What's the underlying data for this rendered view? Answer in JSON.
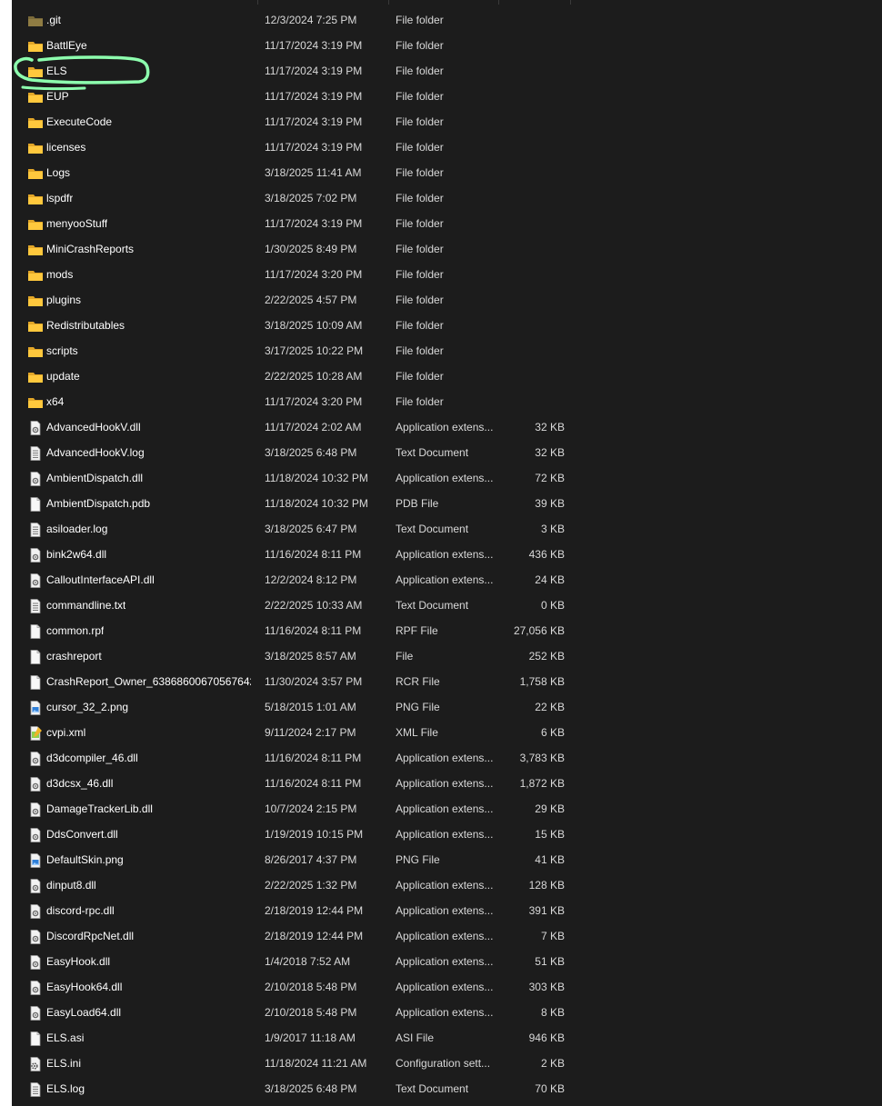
{
  "files": [
    {
      "name": ".git",
      "date": "12/3/2024 7:25 PM",
      "type": "File folder",
      "size": "",
      "icon": "folder-dim-icon"
    },
    {
      "name": "BattlEye",
      "date": "11/17/2024 3:19 PM",
      "type": "File folder",
      "size": "",
      "icon": "folder-icon"
    },
    {
      "name": "ELS",
      "date": "11/17/2024 3:19 PM",
      "type": "File folder",
      "size": "",
      "icon": "folder-icon"
    },
    {
      "name": "EUP",
      "date": "11/17/2024 3:19 PM",
      "type": "File folder",
      "size": "",
      "icon": "folder-icon"
    },
    {
      "name": "ExecuteCode",
      "date": "11/17/2024 3:19 PM",
      "type": "File folder",
      "size": "",
      "icon": "folder-icon"
    },
    {
      "name": "licenses",
      "date": "11/17/2024 3:19 PM",
      "type": "File folder",
      "size": "",
      "icon": "folder-icon"
    },
    {
      "name": "Logs",
      "date": "3/18/2025 11:41 AM",
      "type": "File folder",
      "size": "",
      "icon": "folder-icon"
    },
    {
      "name": "lspdfr",
      "date": "3/18/2025 7:02 PM",
      "type": "File folder",
      "size": "",
      "icon": "folder-icon"
    },
    {
      "name": "menyooStuff",
      "date": "11/17/2024 3:19 PM",
      "type": "File folder",
      "size": "",
      "icon": "folder-icon"
    },
    {
      "name": "MiniCrashReports",
      "date": "1/30/2025 8:49 PM",
      "type": "File folder",
      "size": "",
      "icon": "folder-icon"
    },
    {
      "name": "mods",
      "date": "11/17/2024 3:20 PM",
      "type": "File folder",
      "size": "",
      "icon": "folder-icon"
    },
    {
      "name": "plugins",
      "date": "2/22/2025 4:57 PM",
      "type": "File folder",
      "size": "",
      "icon": "folder-icon"
    },
    {
      "name": "Redistributables",
      "date": "3/18/2025 10:09 AM",
      "type": "File folder",
      "size": "",
      "icon": "folder-icon"
    },
    {
      "name": "scripts",
      "date": "3/17/2025 10:22 PM",
      "type": "File folder",
      "size": "",
      "icon": "folder-icon"
    },
    {
      "name": "update",
      "date": "2/22/2025 10:28 AM",
      "type": "File folder",
      "size": "",
      "icon": "folder-icon"
    },
    {
      "name": "x64",
      "date": "11/17/2024 3:20 PM",
      "type": "File folder",
      "size": "",
      "icon": "folder-icon"
    },
    {
      "name": "AdvancedHookV.dll",
      "date": "11/17/2024 2:02 AM",
      "type": "Application extens...",
      "size": "32 KB",
      "icon": "dll-file-icon"
    },
    {
      "name": "AdvancedHookV.log",
      "date": "3/18/2025 6:48 PM",
      "type": "Text Document",
      "size": "32 KB",
      "icon": "text-file-icon"
    },
    {
      "name": "AmbientDispatch.dll",
      "date": "11/18/2024 10:32 PM",
      "type": "Application extens...",
      "size": "72 KB",
      "icon": "dll-file-icon"
    },
    {
      "name": "AmbientDispatch.pdb",
      "date": "11/18/2024 10:32 PM",
      "type": "PDB File",
      "size": "39 KB",
      "icon": "blank-file-icon"
    },
    {
      "name": "asiloader.log",
      "date": "3/18/2025 6:47 PM",
      "type": "Text Document",
      "size": "3 KB",
      "icon": "text-file-icon"
    },
    {
      "name": "bink2w64.dll",
      "date": "11/16/2024 8:11 PM",
      "type": "Application extens...",
      "size": "436 KB",
      "icon": "dll-file-icon"
    },
    {
      "name": "CalloutInterfaceAPI.dll",
      "date": "12/2/2024 8:12 PM",
      "type": "Application extens...",
      "size": "24 KB",
      "icon": "dll-file-icon"
    },
    {
      "name": "commandline.txt",
      "date": "2/22/2025 10:33 AM",
      "type": "Text Document",
      "size": "0 KB",
      "icon": "text-file-icon"
    },
    {
      "name": "common.rpf",
      "date": "11/16/2024 8:11 PM",
      "type": "RPF File",
      "size": "27,056 KB",
      "icon": "blank-file-icon"
    },
    {
      "name": "crashreport",
      "date": "3/18/2025 8:57 AM",
      "type": "File",
      "size": "252 KB",
      "icon": "blank-file-icon"
    },
    {
      "name": "CrashReport_Owner_63868600670567642...",
      "date": "11/30/2024 3:57 PM",
      "type": "RCR File",
      "size": "1,758 KB",
      "icon": "blank-file-icon"
    },
    {
      "name": "cursor_32_2.png",
      "date": "5/18/2015 1:01 AM",
      "type": "PNG File",
      "size": "22 KB",
      "icon": "image-file-icon"
    },
    {
      "name": "cvpi.xml",
      "date": "9/11/2024 2:17 PM",
      "type": "XML File",
      "size": "6 KB",
      "icon": "xml-file-icon"
    },
    {
      "name": "d3dcompiler_46.dll",
      "date": "11/16/2024 8:11 PM",
      "type": "Application extens...",
      "size": "3,783 KB",
      "icon": "dll-file-icon"
    },
    {
      "name": "d3dcsx_46.dll",
      "date": "11/16/2024 8:11 PM",
      "type": "Application extens...",
      "size": "1,872 KB",
      "icon": "dll-file-icon"
    },
    {
      "name": "DamageTrackerLib.dll",
      "date": "10/7/2024 2:15 PM",
      "type": "Application extens...",
      "size": "29 KB",
      "icon": "dll-file-icon"
    },
    {
      "name": "DdsConvert.dll",
      "date": "1/19/2019 10:15 PM",
      "type": "Application extens...",
      "size": "15 KB",
      "icon": "dll-file-icon"
    },
    {
      "name": "DefaultSkin.png",
      "date": "8/26/2017 4:37 PM",
      "type": "PNG File",
      "size": "41 KB",
      "icon": "image-file-icon"
    },
    {
      "name": "dinput8.dll",
      "date": "2/22/2025 1:32 PM",
      "type": "Application extens...",
      "size": "128 KB",
      "icon": "dll-file-icon"
    },
    {
      "name": "discord-rpc.dll",
      "date": "2/18/2019 12:44 PM",
      "type": "Application extens...",
      "size": "391 KB",
      "icon": "dll-file-icon"
    },
    {
      "name": "DiscordRpcNet.dll",
      "date": "2/18/2019 12:44 PM",
      "type": "Application extens...",
      "size": "7 KB",
      "icon": "dll-file-icon"
    },
    {
      "name": "EasyHook.dll",
      "date": "1/4/2018 7:52 AM",
      "type": "Application extens...",
      "size": "51 KB",
      "icon": "dll-file-icon"
    },
    {
      "name": "EasyHook64.dll",
      "date": "2/10/2018 5:48 PM",
      "type": "Application extens...",
      "size": "303 KB",
      "icon": "dll-file-icon"
    },
    {
      "name": "EasyLoad64.dll",
      "date": "2/10/2018 5:48 PM",
      "type": "Application extens...",
      "size": "8 KB",
      "icon": "dll-file-icon"
    },
    {
      "name": "ELS.asi",
      "date": "1/9/2017 11:18 AM",
      "type": "ASI File",
      "size": "946 KB",
      "icon": "blank-file-icon"
    },
    {
      "name": "ELS.ini",
      "date": "11/18/2024 11:21 AM",
      "type": "Configuration sett...",
      "size": "2 KB",
      "icon": "config-file-icon"
    },
    {
      "name": "ELS.log",
      "date": "3/18/2025 6:48 PM",
      "type": "Text Document",
      "size": "70 KB",
      "icon": "text-file-icon"
    }
  ],
  "colors": {
    "background": "#1c1c1c",
    "folder": "#ffc83d",
    "folder_dark": "#e2a628",
    "text": "#ffffff",
    "highlight": "#8dffae"
  }
}
